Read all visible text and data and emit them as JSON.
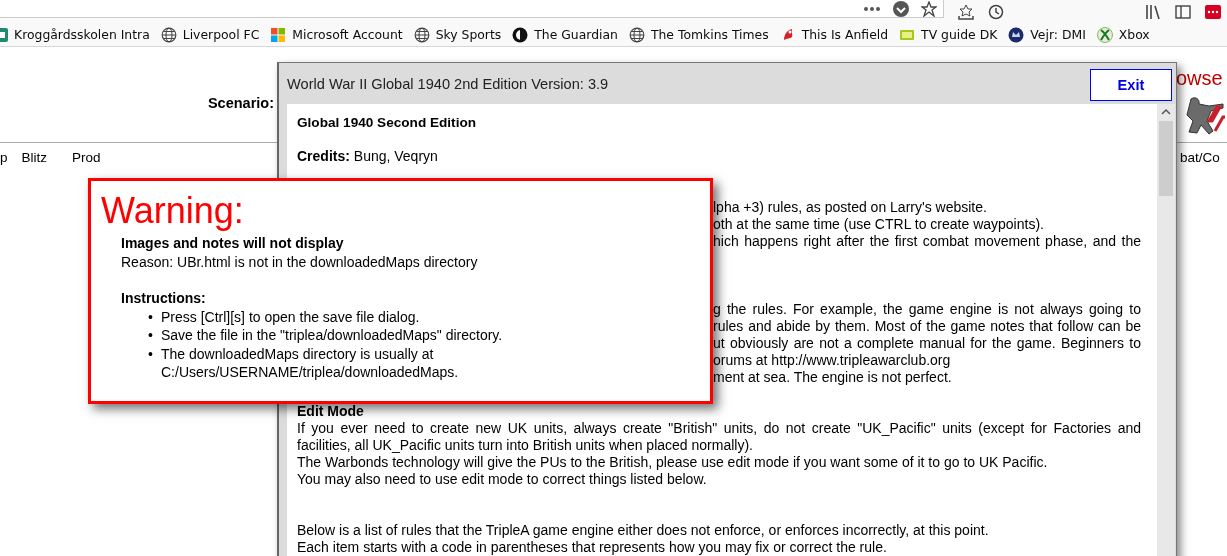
{
  "bookmarks": [
    {
      "label": "Kroggårdsskolen Intra"
    },
    {
      "label": "Liverpool FC"
    },
    {
      "label": "Microsoft Account"
    },
    {
      "label": "Sky Sports"
    },
    {
      "label": "The Guardian"
    },
    {
      "label": "The Tomkins Times"
    },
    {
      "label": "This Is Anfield"
    },
    {
      "label": "TV guide DK"
    },
    {
      "label": "Vejr: DMI"
    },
    {
      "label": "Xbox"
    }
  ],
  "page": {
    "scenario_label": "Scenario:",
    "tabs": [
      "p",
      "Blitz",
      "Prod"
    ],
    "right_heading": "owse",
    "right_tab": "bat/Co"
  },
  "dialog": {
    "title": "World War II Global 1940 2nd Edition Version: 3.9",
    "exit_button": "Exit",
    "body": [
      {
        "kind": "title",
        "text": "Global 1940 Second Edition"
      },
      {
        "kind": "paragraph",
        "text": "**Credits:** Bung, Veqryn"
      },
      {
        "kind": "covered",
        "lines": [
          {
            "kind": "end",
            "text": "lpha +3) rules, as posted on Larry's website."
          },
          {
            "kind": "end",
            "text": "oth at the same time (use CTRL to create waypoints)."
          },
          {
            "kind": "full",
            "text": "hich happens right after the first combat movement phase, and the"
          }
        ]
      },
      {
        "kind": "covered",
        "lines": [
          {
            "kind": "full",
            "text": "g the rules. For example, the game engine is not always going to"
          },
          {
            "kind": "full",
            "text": "rules and abide by them. Most of the game notes that follow can be"
          },
          {
            "kind": "full",
            "text": "ut obviously are not a complete manual for the game. Beginners to"
          },
          {
            "kind": "end",
            "text": "orums at http://www.tripleawarclub.org"
          },
          {
            "kind": "end",
            "text": "ment at sea. The engine is not perfect."
          }
        ]
      },
      {
        "kind": "heading",
        "text": "Edit Mode"
      },
      {
        "kind": "paragraph",
        "text": "If you ever need to create new UK units, always create \"British\" units, do not create \"UK_Pacific\" units (except for Factories and facilities, all UK_Pacific units turn into British units when placed normally)."
      },
      {
        "kind": "paragraph",
        "text": "The Warbonds technology will give the PUs to the British, please use edit mode if you want some of it to go to UK Pacific."
      },
      {
        "kind": "paragraph",
        "text": "You may also need to use edit mode to correct things listed below."
      },
      {
        "kind": "paragraph",
        "text": "Below is a list of rules that the TripleA game engine either does not enforce, or enforces incorrectly, at this point."
      },
      {
        "kind": "paragraph",
        "text": "Each item starts with a code in parentheses that represents how you may fix or correct the rule."
      }
    ]
  },
  "warning": {
    "title": "Warning:",
    "heading": "Images and notes will not display",
    "reason": "Reason: UBr.html is not in the downloadedMaps directory",
    "instructions_title": "Instructions:",
    "items": [
      {
        "bullet": "•",
        "text": "Press [Ctrl][s] to open the save file dialog."
      },
      {
        "bullet": "•",
        "text": "Save the file in the \"triplea/downloadedMaps\" directory."
      },
      {
        "bullet": "•",
        "text": "The downloadedMaps directory is usually at C:/Users/USERNAME/triplea/downloadedMaps."
      }
    ]
  }
}
